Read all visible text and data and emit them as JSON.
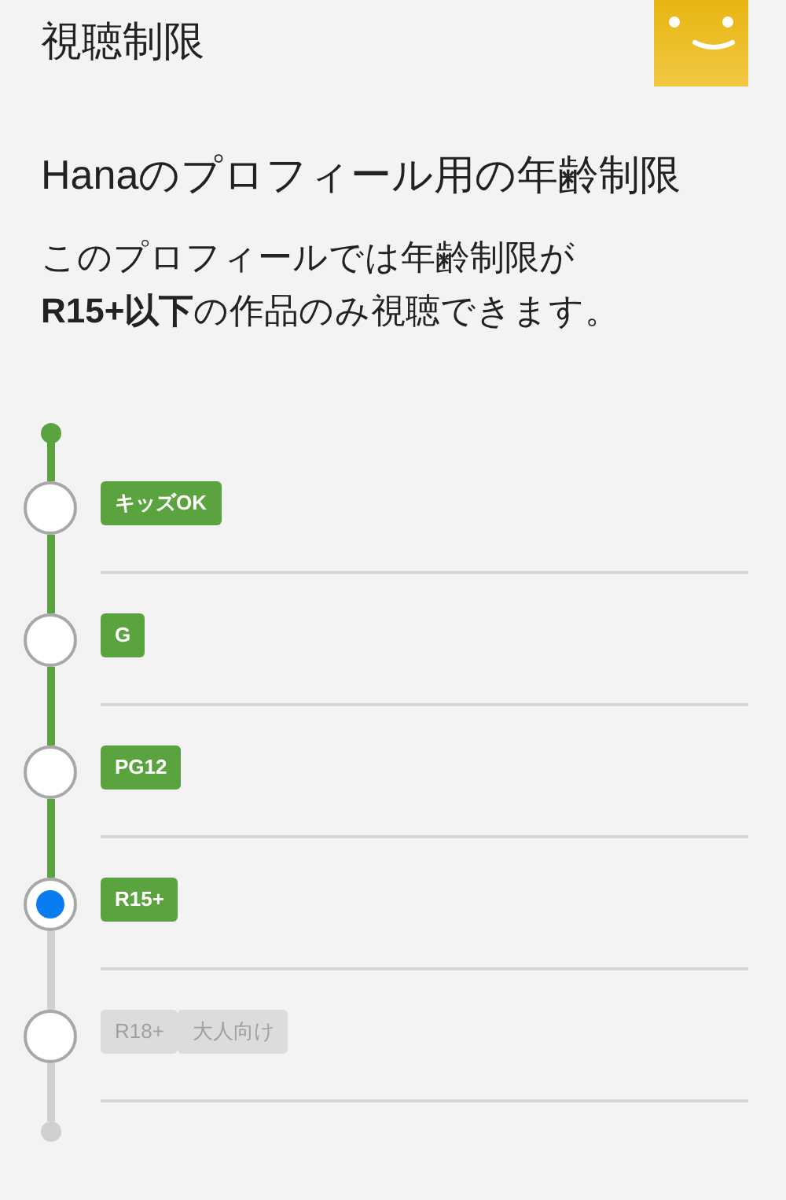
{
  "header": {
    "title": "視聴制限"
  },
  "heading": "Hanaのプロフィール用の年齢制限",
  "description": "このプロフィールでは年齢制限が\n**R15+以下**の作品のみ視聴できます。",
  "levels": [
    {
      "badges": [
        "キッズOK"
      ],
      "included": true,
      "selected": false
    },
    {
      "badges": [
        "G"
      ],
      "included": true,
      "selected": false
    },
    {
      "badges": [
        "PG12"
      ],
      "included": true,
      "selected": false
    },
    {
      "badges": [
        "R15+"
      ],
      "included": true,
      "selected": true
    },
    {
      "badges": [
        "R18+",
        "大人向け"
      ],
      "included": false,
      "selected": false
    }
  ]
}
